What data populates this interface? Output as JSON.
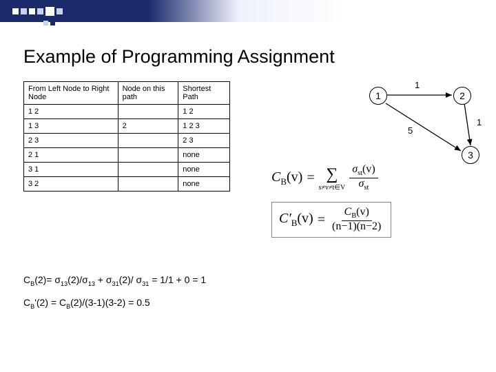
{
  "title": "Example of Programming Assignment",
  "table": {
    "headers": [
      "From Left Node to Right Node",
      "Node on this path",
      "Shortest Path"
    ],
    "rows": [
      [
        "1 2",
        "",
        "1 2"
      ],
      [
        "1 3",
        "2",
        "1 2 3"
      ],
      [
        "2 3",
        "",
        "2 3"
      ],
      [
        "2 1",
        "",
        "none"
      ],
      [
        "3 1",
        "",
        "none"
      ],
      [
        "3 2",
        "",
        "none"
      ]
    ]
  },
  "graph": {
    "nodes": [
      "1",
      "2",
      "3"
    ],
    "edges": [
      {
        "from": "1",
        "to": "2",
        "weight": "1"
      },
      {
        "from": "2",
        "to": "3",
        "weight": "1"
      },
      {
        "from": "1",
        "to": "3",
        "weight": "5"
      }
    ]
  },
  "formula1": {
    "lhs": "C",
    "lhs_sub": "B",
    "lhs_arg": "(v)",
    "eq": "=",
    "sum_sym": "∑",
    "sum_cond": "s≠v≠t∈V",
    "num_left": "σ",
    "num_sub": "st",
    "num_arg": "(v)",
    "den_left": "σ",
    "den_sub": "st"
  },
  "formula2": {
    "lhs": "C′",
    "lhs_sub": "B",
    "lhs_arg": "(v)",
    "eq": "=",
    "num": "C",
    "num_sub": "B",
    "num_arg": "(v)",
    "den": "(n−1)(n−2)"
  },
  "eq1": {
    "pre": "C",
    "sub1": "B",
    "arg1": "(2)= σ",
    "sub2": "13",
    "mid1": "(2)/σ",
    "sub3": "13",
    "mid2": " + σ",
    "sub4": "31",
    "mid3": "(2)/ σ",
    "sub5": "31",
    "tail": " = 1/1 + 0 = 1"
  },
  "eq2": {
    "pre": "C",
    "sub1": "B",
    "mid": "'(2) = C",
    "sub2": "B",
    "tail": "(2)/(3-1)(3-2) = 0.5"
  }
}
